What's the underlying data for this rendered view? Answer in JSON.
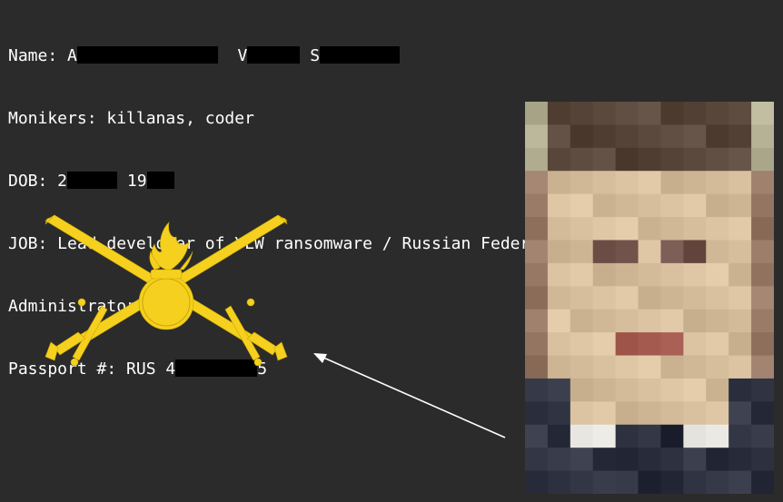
{
  "profile": {
    "name_label": "Name: A",
    "name_mid1": "V",
    "name_mid2": "S",
    "monikers": "Monikers: killanas, coder",
    "dob_prefix": "DOB: 2",
    "dob_mid": "19",
    "job_line1": "JOB: Lead developer of YLW ransomware / Russian Federation MoD Network",
    "job_line2": "Administrator",
    "passport_prefix": "Passport #: RUS 4",
    "passport_suffix": "5"
  },
  "colors": {
    "background": "#2b2b2b",
    "text": "#ffffff",
    "redaction": "#000000",
    "emblem": "#f6d01f",
    "arrow": "#ffffff"
  },
  "icons": {
    "emblem": "crossed-swords-grenade-emblem-icon",
    "arrow": "arrow-pointer",
    "photo": "pixelated-portrait-photo"
  }
}
